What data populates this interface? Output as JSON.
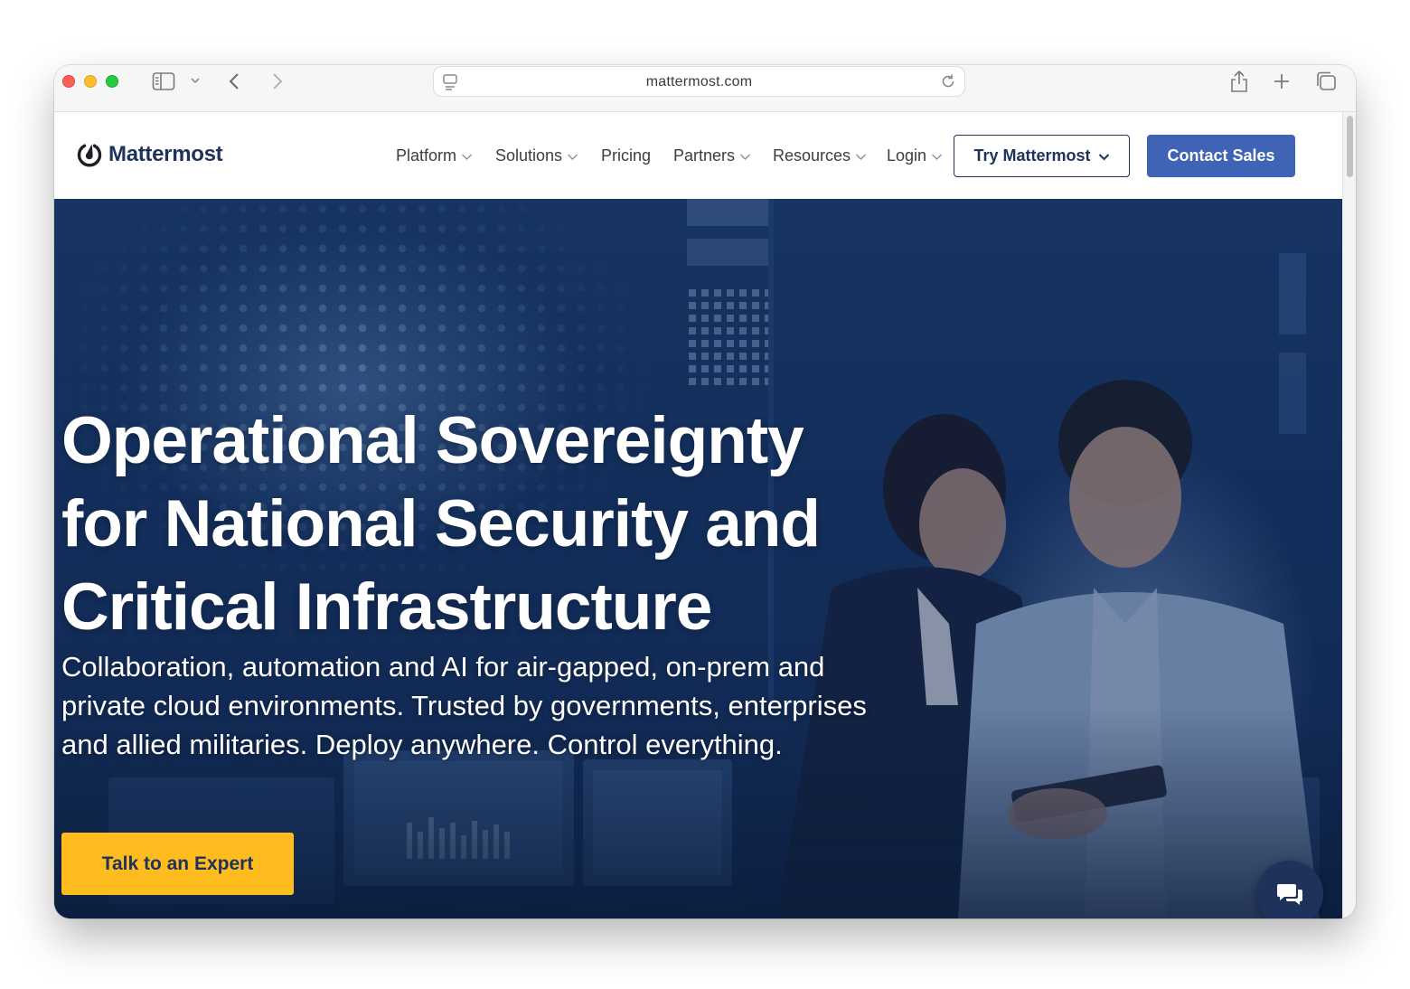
{
  "browser": {
    "url": "mattermost.com"
  },
  "nav": {
    "logo_text": "Mattermost",
    "items": [
      {
        "label": "Platform",
        "has_dropdown": true
      },
      {
        "label": "Solutions",
        "has_dropdown": true
      },
      {
        "label": "Pricing",
        "has_dropdown": false
      },
      {
        "label": "Partners",
        "has_dropdown": true
      },
      {
        "label": "Resources",
        "has_dropdown": true
      },
      {
        "label": "Login",
        "has_dropdown": true
      }
    ],
    "try_label": "Try Mattermost",
    "contact_label": "Contact Sales"
  },
  "hero": {
    "title_lines": [
      "Operational Sovereignty",
      "for National Security and",
      "Critical Infrastructure"
    ],
    "subtitle_lines": [
      "Collaboration, automation and AI for air-gapped, on-prem and",
      "private cloud environments. Trusted by governments, enterprises",
      "and allied militaries. Deploy anywhere. Control everything."
    ],
    "cta_label": "Talk to an Expert"
  },
  "icons": {
    "chat": "chat-bubbles-icon",
    "sidebar": "sidebar-icon",
    "share": "share-icon",
    "new_tab": "plus-icon",
    "tabs": "tab-overview-icon"
  },
  "colors": {
    "brand_navy": "#1e325c",
    "contact_button": "#3f63b5",
    "cta_yellow": "#ffbc1f",
    "hero_blue": "#163462"
  }
}
